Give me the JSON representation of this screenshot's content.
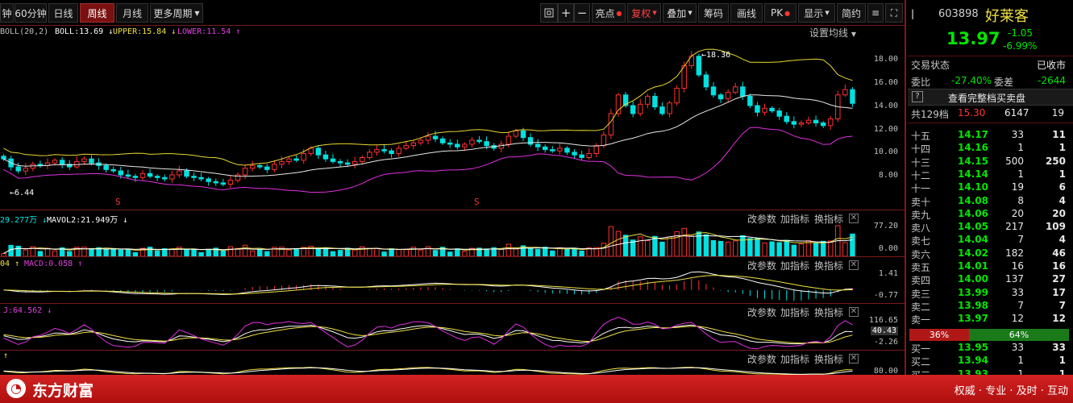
{
  "toolbar": {
    "left": [
      "钟",
      "60分钟",
      "日线",
      "周线",
      "月线",
      "更多周期"
    ],
    "right": [
      "亮点",
      "复权",
      "叠加",
      "筹码",
      "画线",
      "PK",
      "显示",
      "简约"
    ]
  },
  "stock": {
    "code": "603898",
    "name": "好莱客",
    "price": "13.97",
    "change": "-1.05",
    "pct": "-6.99%"
  },
  "boll": {
    "label": "BOLL(20,2)",
    "boll": "BOLL:13.69",
    "upper": "UPPER:15.84",
    "lower": "LOWER:11.54",
    "setting": "设置均线"
  },
  "price_axis": [
    "18.00",
    "16.00",
    "14.00",
    "12.00",
    "10.00",
    "8.00"
  ],
  "annotations": {
    "high": "18.36",
    "low": "6.44",
    "s1": "S",
    "s2": "S"
  },
  "vol": {
    "vol": "29.277万",
    "mavol": "MAVOL2:21.949万",
    "axis_top": "77.20",
    "axis_bottom": "0.00"
  },
  "macd": {
    "left": "04",
    "macd": "MACD:0.058",
    "axis_top": "1.41",
    "axis_bottom": "-0.77"
  },
  "kdj": {
    "j": "J:64.562",
    "axis_top": "116.65",
    "axis_cur": "40.43",
    "axis_bottom": "-2.26"
  },
  "panel5": {
    "axis": "80.00"
  },
  "panel_buttons": {
    "params": "改参数",
    "indicator": "加指标",
    "switch": "换指标",
    "close": "✕"
  },
  "right": {
    "status_label": "交易状态",
    "status_value": "已收市",
    "ratio_label": "委比",
    "ratio_value": "-27.40%",
    "diff_label": "委差",
    "diff_value": "-2644",
    "help": "?",
    "full_book": "查看完整档买卖盘",
    "total_label": "共129档",
    "total_price": "15.30",
    "total_vol": "6147",
    "total_cnt": "19",
    "asks": [
      {
        "label": "十五",
        "price": "14.17",
        "vol": "33",
        "cnt": "11"
      },
      {
        "label": "十四",
        "price": "14.16",
        "vol": "1",
        "cnt": "1"
      },
      {
        "label": "十三",
        "price": "14.15",
        "vol": "500",
        "cnt": "250"
      },
      {
        "label": "十二",
        "price": "14.14",
        "vol": "1",
        "cnt": "1"
      },
      {
        "label": "十一",
        "price": "14.10",
        "vol": "19",
        "cnt": "6"
      },
      {
        "label": "卖十",
        "price": "14.08",
        "vol": "8",
        "cnt": "4"
      },
      {
        "label": "卖九",
        "price": "14.06",
        "vol": "20",
        "cnt": "20"
      },
      {
        "label": "卖八",
        "price": "14.05",
        "vol": "217",
        "cnt": "109"
      },
      {
        "label": "卖七",
        "price": "14.04",
        "vol": "7",
        "cnt": "4"
      },
      {
        "label": "卖六",
        "price": "14.02",
        "vol": "182",
        "cnt": "46"
      },
      {
        "label": "卖五",
        "price": "14.01",
        "vol": "16",
        "cnt": "16"
      },
      {
        "label": "卖四",
        "price": "14.00",
        "vol": "137",
        "cnt": "27"
      },
      {
        "label": "卖三",
        "price": "13.99",
        "vol": "33",
        "cnt": "17"
      },
      {
        "label": "卖二",
        "price": "13.98",
        "vol": "7",
        "cnt": "7"
      },
      {
        "label": "卖一",
        "price": "13.97",
        "vol": "12",
        "cnt": "12"
      }
    ],
    "sell_pct": "36%",
    "buy_pct": "64%",
    "bids": [
      {
        "label": "买一",
        "price": "13.95",
        "vol": "33",
        "cnt": "33"
      },
      {
        "label": "买二",
        "price": "13.94",
        "vol": "1",
        "cnt": "1"
      },
      {
        "label": "买三",
        "price": "13.93",
        "vol": "1",
        "cnt": "1"
      }
    ]
  },
  "footer": {
    "logo": "东方财富",
    "slogan": "权威 · 专业 · 及时 · 互动"
  },
  "chart_data": {
    "type": "candlestick",
    "note": "weekly candles, approximate values read from axis",
    "ylim": [
      6,
      19
    ],
    "close": [
      9.8,
      9.2,
      8.9,
      9.1,
      9.4,
      9.3,
      9.5,
      9.7,
      9.4,
      9.2,
      9.6,
      9.8,
      9.5,
      9.3,
      9.0,
      8.9,
      8.6,
      8.5,
      8.4,
      8.7,
      8.5,
      8.4,
      8.3,
      8.6,
      8.9,
      8.5,
      8.4,
      8.3,
      8.1,
      8.0,
      7.9,
      8.2,
      8.6,
      9.1,
      9.3,
      9.2,
      9.0,
      9.4,
      9.6,
      9.8,
      9.7,
      10.2,
      10.6,
      10.1,
      9.8,
      9.6,
      9.5,
      9.4,
      9.6,
      9.9,
      10.3,
      10.5,
      10.4,
      10.2,
      10.6,
      10.8,
      11.0,
      11.2,
      11.5,
      11.3,
      11.0,
      10.9,
      10.7,
      10.9,
      11.2,
      11.1,
      10.8,
      10.6,
      10.9,
      11.5,
      11.9,
      11.4,
      10.9,
      10.7,
      10.5,
      10.4,
      10.6,
      10.3,
      10.1,
      9.9,
      10.2,
      10.8,
      11.6,
      13.2,
      14.6,
      13.8,
      13.2,
      13.9,
      14.5,
      13.7,
      13.2,
      14.0,
      15.1,
      16.8,
      17.5,
      16.1,
      15.2,
      14.6,
      14.3,
      14.8,
      15.2,
      14.5,
      13.8,
      13.3,
      13.6,
      13.4,
      13.0,
      12.6,
      12.4,
      12.5,
      12.7,
      12.5,
      12.3,
      12.8,
      14.6,
      15.0,
      13.97
    ]
  }
}
